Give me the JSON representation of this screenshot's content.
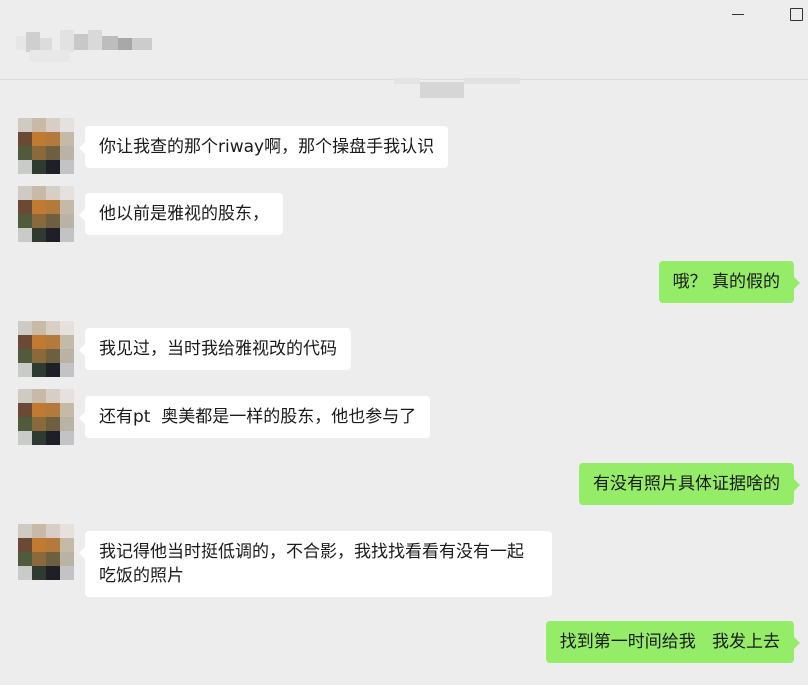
{
  "window": {
    "minimize_glyph": "minimize-icon",
    "maximize_glyph": "maximize-icon"
  },
  "colors": {
    "background": "#ededed",
    "bubble_self": "#95ec69",
    "bubble_other": "#ffffff"
  },
  "messages": [
    {
      "side": "left",
      "text": "你让我查的那个riway啊，那个操盘手我认识"
    },
    {
      "side": "left",
      "text": "他以前是雅视的股东，"
    },
    {
      "side": "right",
      "text": "哦？ 真的假的"
    },
    {
      "side": "left",
      "text": "我见过，当时我给雅视改的代码"
    },
    {
      "side": "left",
      "text": "还有pt  奥美都是一样的股东，他也参与了"
    },
    {
      "side": "right",
      "text": "有没有照片具体证据啥的"
    },
    {
      "side": "left",
      "text": "我记得他当时挺低调的，不合影，我找找看看有没有一起\n吃饭的照片"
    },
    {
      "side": "right",
      "text": "找到第一时间给我   我发上去"
    }
  ]
}
